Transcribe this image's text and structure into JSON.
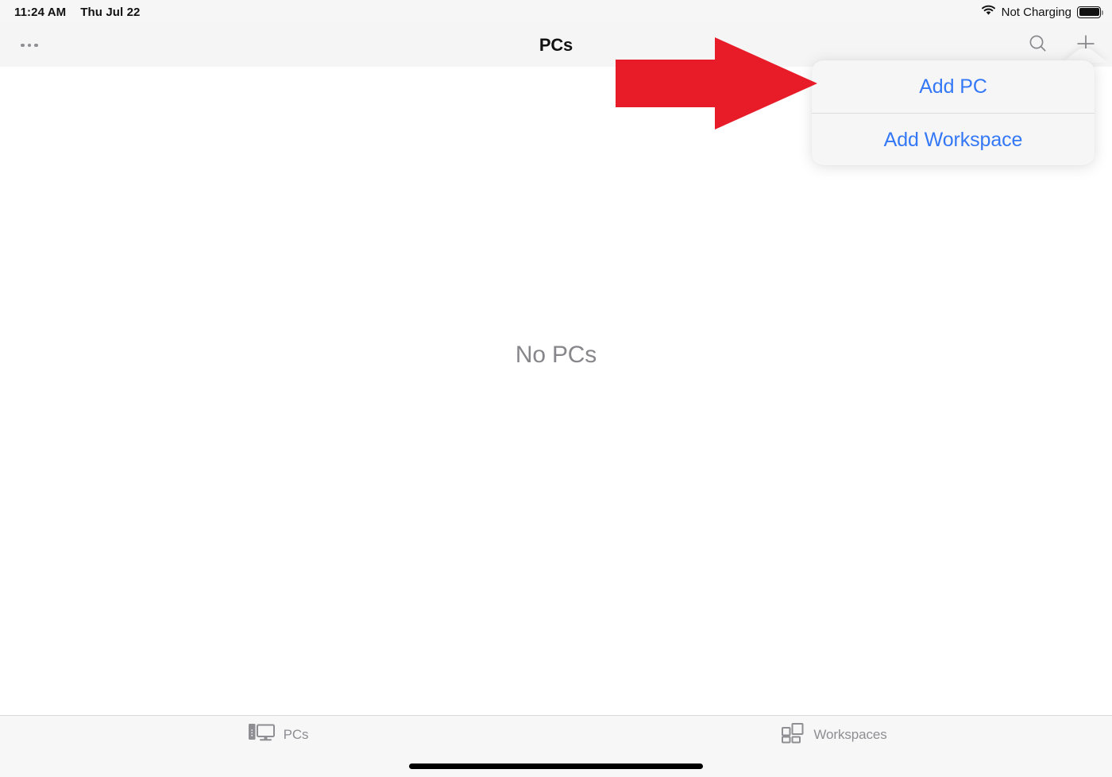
{
  "status_bar": {
    "time": "11:24 AM",
    "date": "Thu Jul 22",
    "battery_text": "Not Charging",
    "wifi_icon": "wifi-icon",
    "battery_icon": "battery-full-icon"
  },
  "nav_bar": {
    "title": "PCs",
    "more_icon": "ellipsis-icon",
    "search_icon": "search-icon",
    "add_icon": "plus-icon"
  },
  "content": {
    "empty_state_label": "No PCs"
  },
  "popover": {
    "items": [
      {
        "label": "Add PC"
      },
      {
        "label": "Add Workspace"
      }
    ],
    "accent_color": "#3478f6"
  },
  "annotation": {
    "type": "arrow",
    "direction": "right",
    "color": "#e81c29",
    "points_to": "Add PC"
  },
  "tab_bar": {
    "tabs": [
      {
        "label": "PCs",
        "icon": "desktop-computer-icon",
        "selected": false
      },
      {
        "label": "Workspaces",
        "icon": "grid-squares-icon",
        "selected": false
      }
    ]
  }
}
